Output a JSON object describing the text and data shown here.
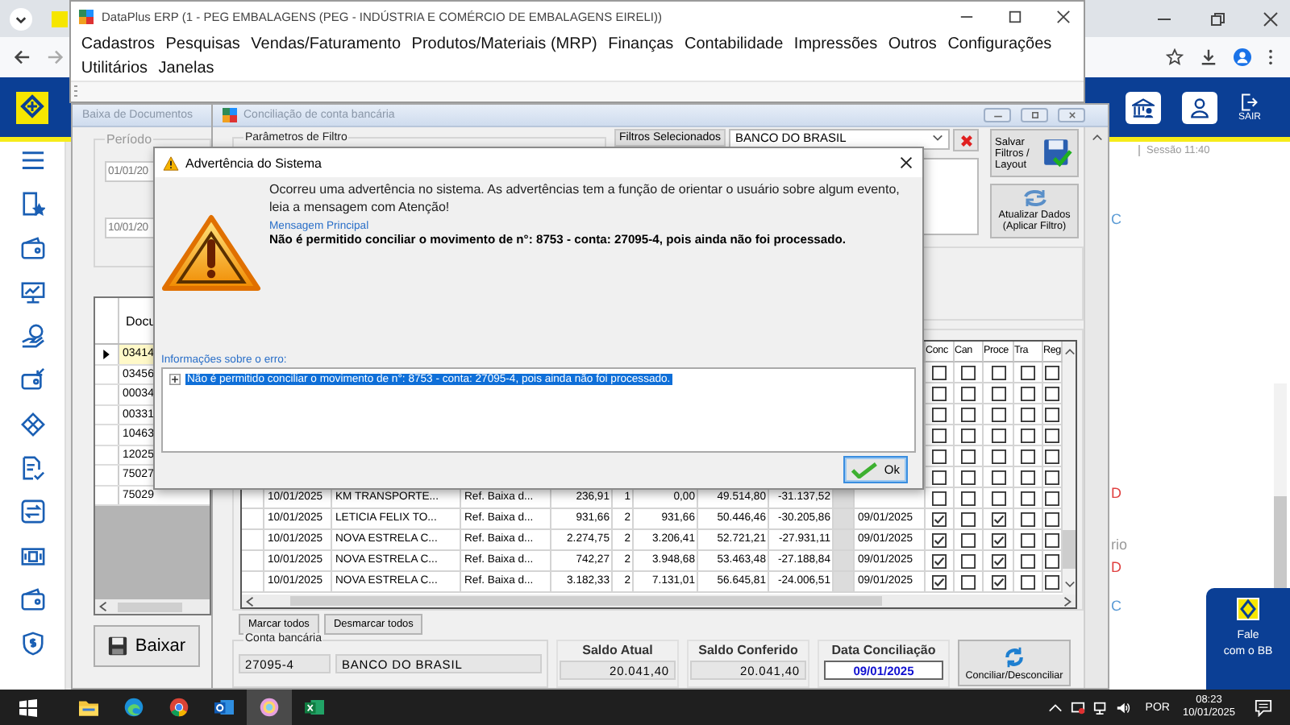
{
  "browser": {
    "exit_label": "SAIR",
    "session": "Sessão 11:40",
    "page_fragments": [
      {
        "text": "C",
        "kind": "link"
      },
      {
        "text": "D",
        "kind": "alert"
      },
      {
        "text": "rio",
        "kind": "plain"
      },
      {
        "text": "D",
        "kind": "alert"
      },
      {
        "text": "C",
        "kind": "link"
      }
    ],
    "chat": [
      "Fale",
      "com o BB"
    ]
  },
  "erp": {
    "title": "DataPlus ERP (1 - PEG EMBALAGENS  (PEG - INDÚSTRIA E COMÉRCIO DE EMBALAGENS EIRELI))",
    "menu": [
      "Cadastros",
      "Pesquisas",
      "Vendas/Faturamento",
      "Produtos/Materiais (MRP)",
      "Finanças",
      "Contabilidade",
      "Impressões",
      "Outros",
      "Configurações",
      "Utilitários",
      "Janelas"
    ]
  },
  "baixa": {
    "title": "Baixa de Documentos",
    "period_label": "Período",
    "date_from": "01/01/20",
    "date_to": "10/01/20",
    "doc_column": "Docu",
    "docs": [
      {
        "number": "03414",
        "selected": true
      },
      {
        "number": "03456",
        "selected": false
      },
      {
        "number": "00034",
        "selected": false
      },
      {
        "number": "00331",
        "selected": false
      },
      {
        "number": "10463",
        "selected": false
      },
      {
        "number": "12025",
        "selected": false
      },
      {
        "number": "75027",
        "selected": false
      },
      {
        "number": "75029",
        "selected": false
      }
    ],
    "baixar": "Baixar"
  },
  "conciliacao": {
    "title": "Conciliação de conta bancária",
    "filter_group": "Parâmetros de Filtro",
    "selected_filters_label": "Filtros Selecionados",
    "bank_filter": "BANCO DO BRASIL",
    "save_button": "Salvar Filtros / Layout",
    "refresh_button": "Atualizar Dados (Aplicar Filtro)",
    "check_columns": [
      "Conc",
      "Can",
      "Proce",
      "Tra",
      "Reg"
    ],
    "rows": [
      {
        "checks": [
          false,
          false,
          false,
          false,
          false
        ]
      },
      {
        "checks": [
          false,
          false,
          false,
          false,
          false
        ]
      },
      {
        "checks": [
          false,
          false,
          false,
          false,
          false
        ]
      },
      {
        "checks": [
          false,
          false,
          false,
          false,
          false
        ]
      },
      {
        "checks": [
          false,
          false,
          false,
          false,
          false
        ]
      },
      {
        "checks": [
          false,
          false,
          false,
          false,
          false
        ]
      },
      {
        "cells": [
          "10/01/2025",
          "KM TRANSPORTE...",
          "Ref. Baixa d...",
          "236,91",
          "1",
          "0,00",
          "49.514,80",
          "-31.137,52"
        ],
        "checks": [
          false,
          false,
          false,
          false,
          false
        ]
      },
      {
        "cells": [
          "10/01/2025",
          "LETICIA FELIX TO...",
          "Ref. Baixa d...",
          "931,66",
          "2",
          "931,66",
          "50.446,46",
          "-30.205,86"
        ],
        "reconciled_on": "09/01/2025",
        "checks": [
          true,
          false,
          true,
          false,
          false
        ]
      },
      {
        "cells": [
          "10/01/2025",
          "NOVA ESTRELA C...",
          "Ref. Baixa d...",
          "2.274,75",
          "2",
          "3.206,41",
          "52.721,21",
          "-27.931,11"
        ],
        "reconciled_on": "09/01/2025",
        "checks": [
          true,
          false,
          true,
          false,
          false
        ]
      },
      {
        "cells": [
          "10/01/2025",
          "NOVA ESTRELA C...",
          "Ref. Baixa d...",
          "742,27",
          "2",
          "3.948,68",
          "53.463,48",
          "-27.188,84"
        ],
        "reconciled_on": "09/01/2025",
        "checks": [
          true,
          false,
          true,
          false,
          false
        ]
      },
      {
        "cells": [
          "10/01/2025",
          "NOVA ESTRELA C...",
          "Ref. Baixa d...",
          "3.182,33",
          "2",
          "7.131,01",
          "56.645,81",
          "-24.006,51"
        ],
        "reconciled_on": "09/01/2025",
        "checks": [
          true,
          false,
          true,
          false,
          false
        ]
      }
    ],
    "mark_all": "Marcar todos",
    "unmark_all": "Desmarcar todos",
    "account_group": "Conta bancária",
    "account_number": "27095-4",
    "account_bank": "BANCO DO BRASIL",
    "balance_label": "Saldo Atual",
    "balance": "20.041,40",
    "checked_label": "Saldo Conferido",
    "checked_balance": "20.041,40",
    "date_label": "Data Conciliação",
    "date": "09/01/2025",
    "reconcile_button": "Conciliar/Desconciliar"
  },
  "dialog": {
    "title": "Advertência do Sistema",
    "intro": "Ocorreu uma advertência no sistema. As advertências tem a função de orientar o usuário sobre algum evento, leia a mensagem com Atenção!",
    "message_label": "Mensagem Principal",
    "message": "Não é permitido conciliar o movimento de n°: 8753 - conta: 27095-4, pois ainda não foi processado.",
    "info_label": "Informações sobre o erro:",
    "info_items": [
      {
        "text": "Não é permitido conciliar o movimento de n°: 8753 - conta: 27095-4, pois ainda não foi processado.",
        "selected": true
      }
    ],
    "ok": "Ok"
  },
  "taskbar": {
    "apps": [
      {
        "kind": "explorer",
        "active": false
      },
      {
        "kind": "edge",
        "active": false
      },
      {
        "kind": "chrome",
        "active": false
      },
      {
        "kind": "outlook",
        "active": false
      },
      {
        "kind": "paint",
        "active": true
      },
      {
        "kind": "excel",
        "active": false
      }
    ],
    "language": "POR",
    "time": "08:23",
    "date": "10/01/2025"
  }
}
